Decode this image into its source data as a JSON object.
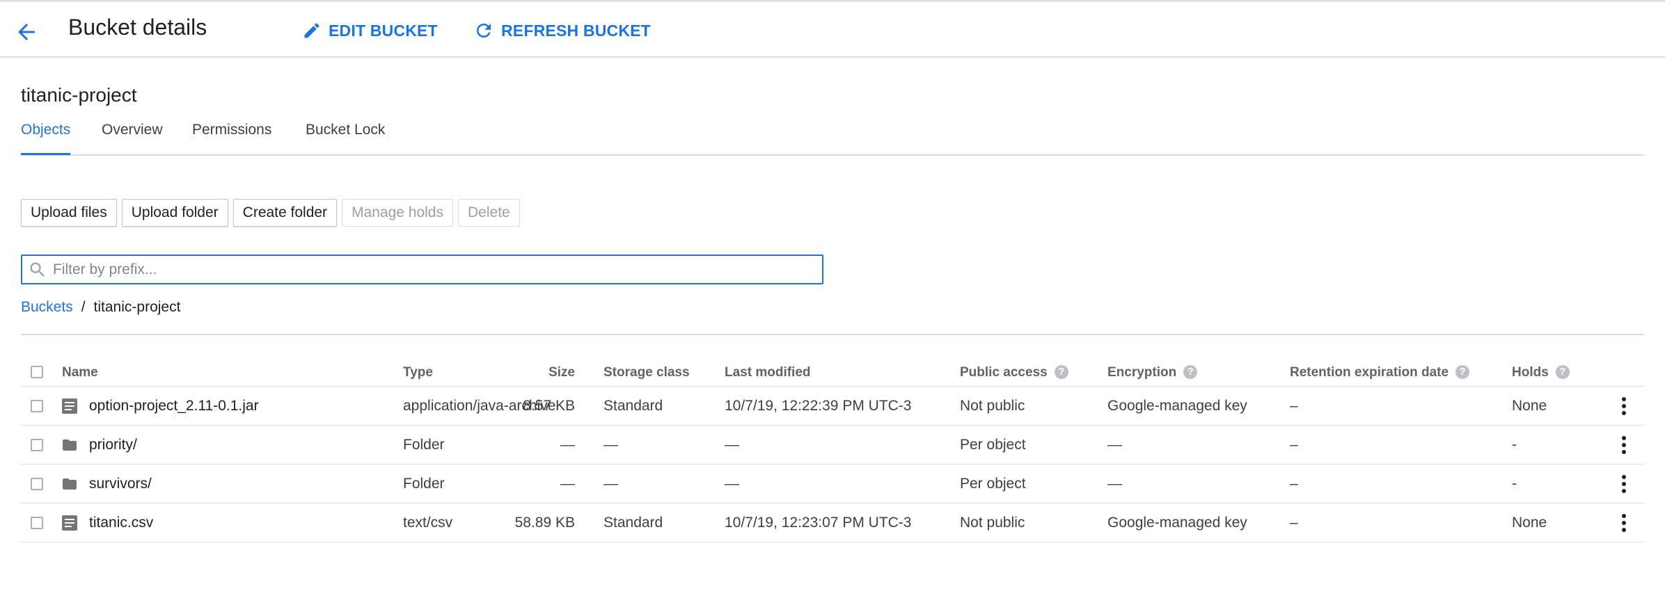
{
  "header": {
    "title": "Bucket details",
    "edit_label": "EDIT BUCKET",
    "refresh_label": "REFRESH BUCKET"
  },
  "bucket": {
    "name": "titanic-project"
  },
  "tabs": [
    {
      "label": "Objects",
      "active": true
    },
    {
      "label": "Overview",
      "active": false
    },
    {
      "label": "Permissions",
      "active": false
    },
    {
      "label": "Bucket Lock",
      "active": false
    }
  ],
  "toolbar": {
    "upload_files": "Upload files",
    "upload_folder": "Upload folder",
    "create_folder": "Create folder",
    "manage_holds": "Manage holds",
    "delete": "Delete"
  },
  "filter": {
    "placeholder": "Filter by prefix..."
  },
  "breadcrumb": {
    "root": "Buckets",
    "separator": "/",
    "current": "titanic-project"
  },
  "table": {
    "headers": {
      "name": "Name",
      "size": "Size",
      "type": "Type",
      "storage_class": "Storage class",
      "last_modified": "Last modified",
      "public_access": "Public access",
      "encryption": "Encryption",
      "retention": "Retention expiration date",
      "holds": "Holds"
    },
    "rows": [
      {
        "icon": "file-icon",
        "name": "option-project_2.11-0.1.jar",
        "size": "8.57 KB",
        "type": "application/java-archive",
        "storage_class": "Standard",
        "last_modified": "10/7/19, 12:22:39 PM UTC-3",
        "public_access": "Not public",
        "encryption": "Google-managed key",
        "retention": "–",
        "holds": "None"
      },
      {
        "icon": "folder-icon",
        "name": "priority/",
        "size": "—",
        "type": "Folder",
        "storage_class": "—",
        "last_modified": "—",
        "public_access": "Per object",
        "encryption": "—",
        "retention": "–",
        "holds": "-"
      },
      {
        "icon": "folder-icon",
        "name": "survivors/",
        "size": "—",
        "type": "Folder",
        "storage_class": "—",
        "last_modified": "—",
        "public_access": "Per object",
        "encryption": "—",
        "retention": "–",
        "holds": "-"
      },
      {
        "icon": "file-icon",
        "name": "titanic.csv",
        "size": "58.89 KB",
        "type": "text/csv",
        "storage_class": "Standard",
        "last_modified": "10/7/19, 12:23:07 PM UTC-3",
        "public_access": "Not public",
        "encryption": "Google-managed key",
        "retention": "–",
        "holds": "None"
      }
    ]
  },
  "colors": {
    "accent": "#1a73e8",
    "divider": "#dadce0",
    "icon_gray": "#757575"
  }
}
